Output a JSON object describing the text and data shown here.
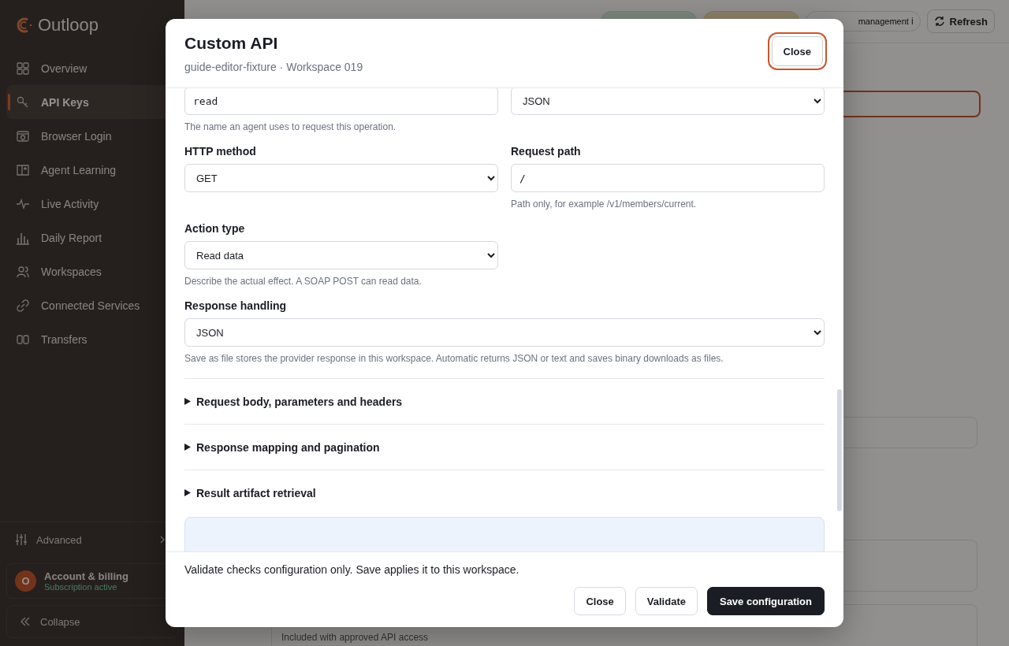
{
  "sidebar": {
    "brand": "Outloop",
    "items": [
      {
        "label": "Overview",
        "selected": false
      },
      {
        "label": "API Keys",
        "selected": true
      },
      {
        "label": "Browser Login",
        "selected": false
      },
      {
        "label": "Agent Learning",
        "selected": false
      },
      {
        "label": "Live Activity",
        "selected": false
      },
      {
        "label": "Daily Report",
        "selected": false
      },
      {
        "label": "Workspaces",
        "selected": false
      },
      {
        "label": "Connected Services",
        "selected": false
      },
      {
        "label": "Transfers",
        "selected": false
      }
    ],
    "advanced": "Advanced",
    "account": {
      "initial": "O",
      "name": "Account & billing",
      "status": "Subscription active"
    },
    "collapse": "Collapse"
  },
  "page": {
    "management": "management",
    "info_mark": "i",
    "refresh": "Refresh",
    "footnote": "Included with approved API access"
  },
  "modal": {
    "title": "Custom API",
    "subtitle": "guide-editor-fixture · Workspace 019",
    "close": "Close",
    "fields": [
      {
        "kind": "input",
        "value": "read",
        "hint": "The name an agent uses to request this operation."
      },
      {
        "kind": "select",
        "value": "JSON"
      },
      {
        "kind": "select",
        "label": "HTTP method",
        "value": "GET"
      },
      {
        "kind": "input",
        "label": "Request path",
        "value": "/",
        "hint": "Path only, for example /v1/members/current."
      },
      {
        "kind": "select",
        "label": "Action type",
        "value": "Read data",
        "hint": "Describe the actual effect. A SOAP POST can read data."
      }
    ],
    "response_handling": {
      "label": "Response handling",
      "value": "JSON",
      "hint": "Save as file stores the provider response in this workspace. Automatic returns JSON or text and saves binary downloads as files."
    },
    "sections": [
      {
        "title": "Request body, parameters and headers",
        "expanded": false
      },
      {
        "title": "Response mapping and pagination",
        "expanded": false
      },
      {
        "title": "Result artifact retrieval",
        "expanded": false
      }
    ],
    "footer_note": "Validate checks configuration only. Save applies it to this workspace.",
    "buttons": [
      {
        "label": "Close",
        "kind": "secondary"
      },
      {
        "label": "Validate",
        "kind": "secondary"
      },
      {
        "label": "Save configuration",
        "kind": "primary"
      }
    ]
  }
}
